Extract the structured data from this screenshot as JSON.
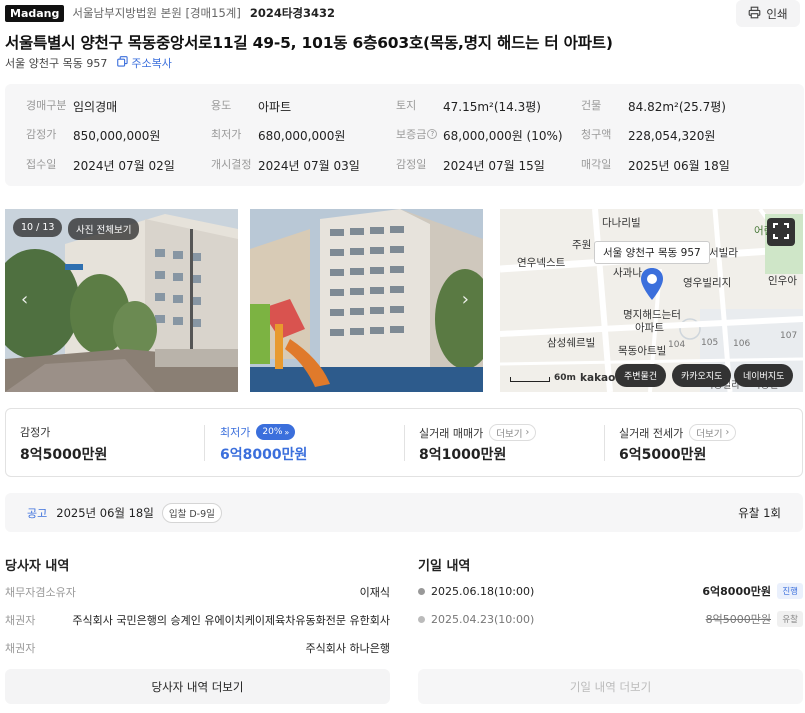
{
  "header": {
    "brand": "Madang",
    "court": "서울남부지방법원 본원 [경매15계]",
    "case_number": "2024타경3432",
    "print_label": "인쇄"
  },
  "property": {
    "title": "서울특별시 양천구 목동중앙서로11길 49-5, 101동 6층603호(목동,명지 해드는 터 아파트)",
    "short_address": "서울 양천구 목동 957",
    "copy_label": "주소복사"
  },
  "info": [
    [
      {
        "label": "경매구분",
        "value": "임의경매"
      },
      {
        "label": "용도",
        "value": "아파트"
      },
      {
        "label": "토지",
        "value": "47.15m²(14.3평)"
      },
      {
        "label": "건물",
        "value": "84.82m²(25.7평)"
      }
    ],
    [
      {
        "label": "감정가",
        "value": "850,000,000원"
      },
      {
        "label": "최저가",
        "value": "680,000,000원"
      },
      {
        "label": "보증금",
        "value": "68,000,000원 (10%)"
      },
      {
        "label": "청구액",
        "value": "228,054,320원"
      }
    ],
    [
      {
        "label": "접수일",
        "value": "2024년 07월 02일"
      },
      {
        "label": "개시결정",
        "value": "2024년 07월 03일"
      },
      {
        "label": "감정일",
        "value": "2024년 07월 15일"
      },
      {
        "label": "매각일",
        "value": "2025년 06월 18일"
      }
    ]
  ],
  "gallery": {
    "counter": "10 / 13",
    "view_all_label": "사진 전체보기"
  },
  "map": {
    "tooltip": "서울 양천구 목동 957",
    "labels": [
      "다나리빌",
      "주원",
      "연우넥스트",
      "사과나",
      "서빌라",
      "영우빌리지",
      "인우아",
      "명지해드는터",
      "아파트",
      "삼성쉐르빌",
      "목동아트빌",
      "104",
      "105",
      "106",
      "107",
      "어린이집",
      "목동빌라",
      "목동빌"
    ],
    "scale_label": "60m",
    "provider": "kakao",
    "buttons": [
      "주변물건",
      "카카오지도",
      "네이버지도"
    ]
  },
  "prices": {
    "appraisal_label": "감정가",
    "appraisal_value": "8억5000만원",
    "minimum_label": "최저가",
    "minimum_pct": "20%",
    "minimum_value": "6억8000만원",
    "sale_label": "실거래 매매가",
    "sale_value": "8억1000만원",
    "jeonse_label": "실거래 전세가",
    "jeonse_value": "6억5000만원",
    "more_label": "더보기"
  },
  "notice": {
    "label": "공고",
    "date": "2025년 06월 18일",
    "dday": "입찰 D-9일",
    "yuchal": "유찰 1회"
  },
  "parties": {
    "title": "당사자 내역",
    "rows": [
      {
        "role": "채무자겸소유자",
        "name": "이재식"
      },
      {
        "role": "채권자",
        "name": "주식회사 국민은행의 승계인 유에이치케이제육차유동화전문 유한회사"
      },
      {
        "role": "채권자",
        "name": "주식회사 하나은행"
      }
    ],
    "more_label": "당사자 내역 더보기"
  },
  "history": {
    "title": "기일 내역",
    "rows": [
      {
        "date": "2025.06.18(10:00)",
        "price": "6억8000만원",
        "status": "진행"
      },
      {
        "date": "2025.04.23(10:00)",
        "price": "8억5000만원",
        "status": "유찰"
      }
    ],
    "more_label": "기일 내역 더보기"
  },
  "colors": {
    "accent": "#3b6fdc",
    "panel_bg": "#f6f6f7",
    "map_pin": "#3b6fdc"
  }
}
